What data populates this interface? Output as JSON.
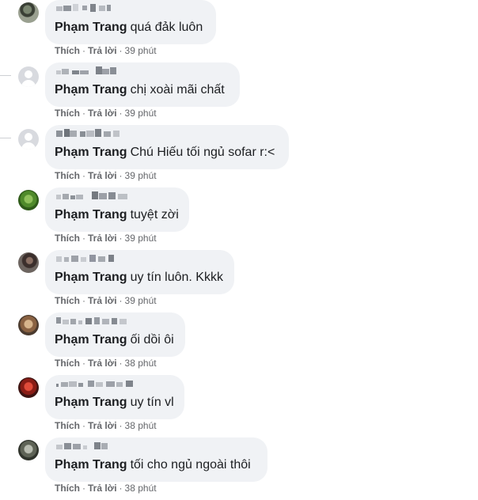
{
  "comments": [
    {
      "author_name": "",
      "tag": "Phạm Trang",
      "text": "quá đảk luôn",
      "like_label": "Thích",
      "reply_label": "Trả lời",
      "separator": "·",
      "time": "39 phút",
      "avatar": "avatar-photo-icon"
    },
    {
      "author_name": "",
      "tag": "Phạm Trang",
      "text": "chị xoài mãi chất",
      "like_label": "Thích",
      "reply_label": "Trả lời",
      "separator": "·",
      "time": "39 phút",
      "avatar": "default-avatar-icon"
    },
    {
      "author_name": "",
      "tag": "Phạm Trang",
      "text": "Chú Hiếu tối ngủ sofar r:<",
      "like_label": "Thích",
      "reply_label": "Trả lời",
      "separator": "·",
      "time": "39 phút",
      "avatar": "default-avatar-icon"
    },
    {
      "author_name": "",
      "tag": "Phạm Trang",
      "text": "tuyệt zời",
      "like_label": "Thích",
      "reply_label": "Trả lời",
      "separator": "·",
      "time": "39 phút",
      "avatar": "avatar-photo-icon"
    },
    {
      "author_name": "",
      "tag": "Phạm Trang",
      "text": "uy tín luôn. Kkkk",
      "like_label": "Thích",
      "reply_label": "Trả lời",
      "separator": "·",
      "time": "39 phút",
      "avatar": "avatar-photo-icon"
    },
    {
      "author_name": "",
      "tag": "Phạm Trang",
      "text": "ối dồi ôi",
      "like_label": "Thích",
      "reply_label": "Trả lời",
      "separator": "·",
      "time": "38 phút",
      "avatar": "avatar-photo-icon"
    },
    {
      "author_name": "",
      "tag": "Phạm Trang",
      "text": "uy tín vl",
      "like_label": "Thích",
      "reply_label": "Trả lời",
      "separator": "·",
      "time": "38 phút",
      "avatar": "avatar-photo-icon"
    },
    {
      "author_name": "",
      "tag": "Phạm Trang",
      "text": "tối cho ngủ ngoài thôi",
      "like_label": "Thích",
      "reply_label": "Trả lời",
      "separator": "·",
      "time": "38 phút",
      "avatar": "avatar-photo-icon"
    }
  ],
  "colors": {
    "bubble_bg": "#f0f2f5",
    "text": "#1c1e21",
    "meta": "#65676b",
    "thread_line": "#ced0d4"
  }
}
